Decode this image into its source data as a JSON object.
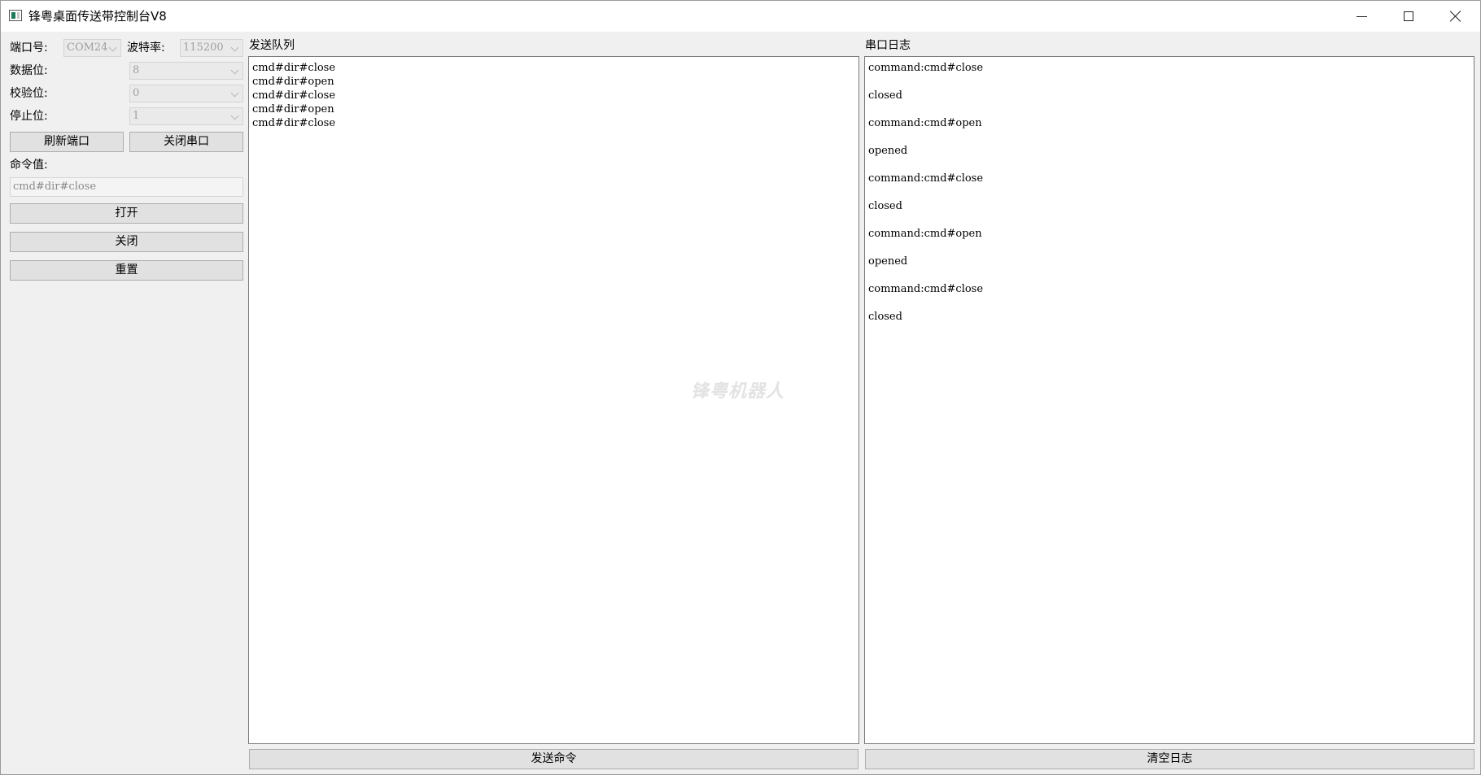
{
  "window": {
    "title": "锋粤桌面传送带控制台V8"
  },
  "serial": {
    "port_label": "端口号:",
    "port_value": "COM24",
    "baud_label": "波特率:",
    "baud_value": "115200",
    "databits_label": "数据位:",
    "databits_value": "8",
    "parity_label": "校验位:",
    "parity_value": "0",
    "stopbits_label": "停止位:",
    "stopbits_value": "1",
    "refresh_label": "刷新端口",
    "close_port_label": "关闭串口"
  },
  "command": {
    "label": "命令值:",
    "value": "cmd#dir#close",
    "open_label": "打开",
    "close_label": "关闭",
    "reset_label": "重置"
  },
  "queue": {
    "title": "发送队列",
    "lines": [
      "cmd#dir#close",
      "cmd#dir#open",
      "cmd#dir#close",
      "cmd#dir#open",
      "cmd#dir#close"
    ],
    "send_label": "发送命令"
  },
  "log": {
    "title": "串口日志",
    "lines": [
      "command:cmd#close",
      "closed",
      "command:cmd#open",
      "opened",
      "command:cmd#close",
      "closed",
      "command:cmd#open",
      "opened",
      "command:cmd#close",
      "closed"
    ],
    "clear_label": "清空日志"
  },
  "watermark": "锋粤机器人"
}
